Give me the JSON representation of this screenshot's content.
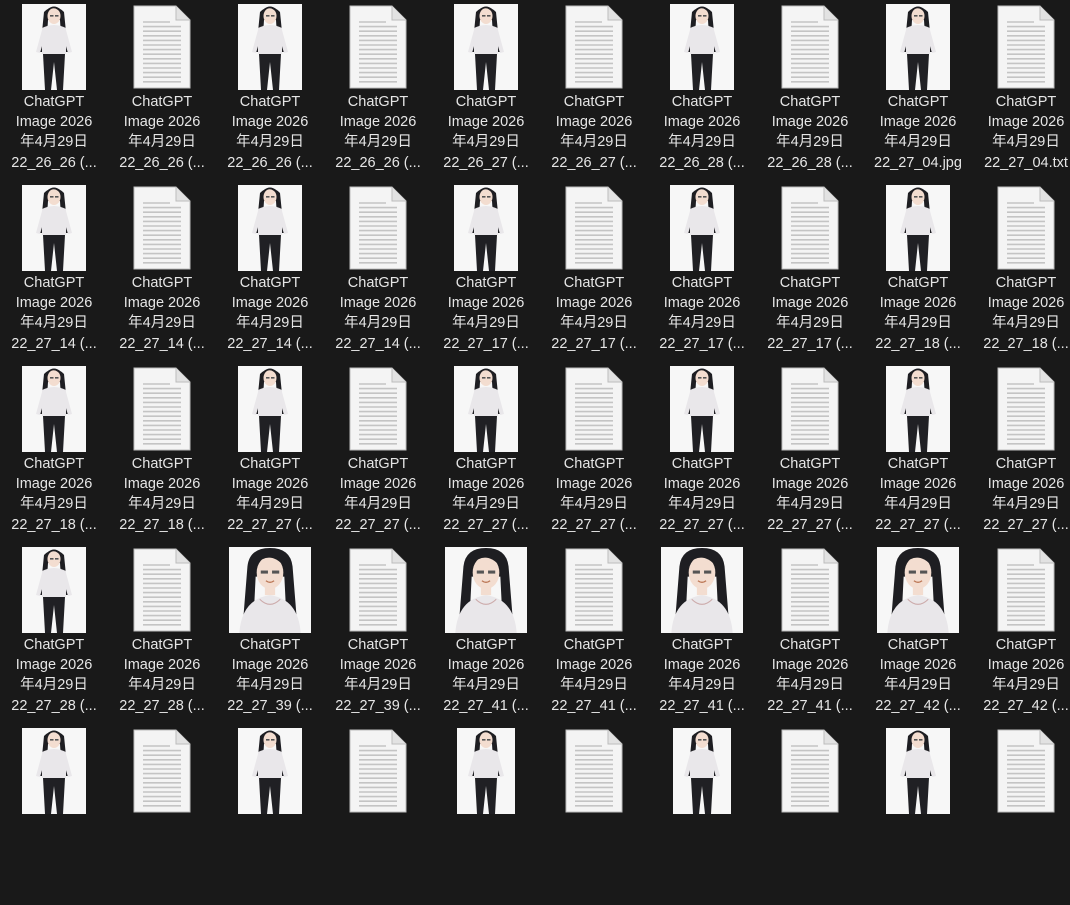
{
  "explorer": {
    "view": "large-icons",
    "items": [
      {
        "kind": "image",
        "icon": "image-thumbnail-icon",
        "lines": [
          "ChatGPT",
          "Image 2026",
          "年4月29日",
          "22_26_26 (..."
        ]
      },
      {
        "kind": "text",
        "icon": "text-file-icon",
        "lines": [
          "ChatGPT",
          "Image 2026",
          "年4月29日",
          "22_26_26 (..."
        ]
      },
      {
        "kind": "image",
        "icon": "image-thumbnail-icon",
        "lines": [
          "ChatGPT",
          "Image 2026",
          "年4月29日",
          "22_26_26 (..."
        ]
      },
      {
        "kind": "text",
        "icon": "text-file-icon",
        "lines": [
          "ChatGPT",
          "Image 2026",
          "年4月29日",
          "22_26_26 (..."
        ]
      },
      {
        "kind": "image",
        "icon": "image-thumbnail-icon",
        "lines": [
          "ChatGPT",
          "Image 2026",
          "年4月29日",
          "22_26_27 (..."
        ]
      },
      {
        "kind": "text",
        "icon": "text-file-icon",
        "lines": [
          "ChatGPT",
          "Image 2026",
          "年4月29日",
          "22_26_27 (..."
        ]
      },
      {
        "kind": "image",
        "icon": "image-thumbnail-icon",
        "lines": [
          "ChatGPT",
          "Image 2026",
          "年4月29日",
          "22_26_28 (..."
        ]
      },
      {
        "kind": "text",
        "icon": "text-file-icon",
        "lines": [
          "ChatGPT",
          "Image 2026",
          "年4月29日",
          "22_26_28 (..."
        ]
      },
      {
        "kind": "image",
        "icon": "image-thumbnail-icon",
        "lines": [
          "ChatGPT",
          "Image 2026",
          "年4月29日",
          "22_27_04.jpg"
        ]
      },
      {
        "kind": "text",
        "icon": "text-file-icon",
        "lines": [
          "ChatGPT",
          "Image 2026",
          "年4月29日",
          "22_27_04.txt"
        ]
      },
      {
        "kind": "image",
        "icon": "image-thumbnail-icon",
        "lines": [
          "ChatGPT",
          "Image 2026",
          "年4月29日",
          "22_27_14 (..."
        ]
      },
      {
        "kind": "text",
        "icon": "text-file-icon",
        "lines": [
          "ChatGPT",
          "Image 2026",
          "年4月29日",
          "22_27_14 (..."
        ]
      },
      {
        "kind": "image",
        "icon": "image-thumbnail-icon",
        "lines": [
          "ChatGPT",
          "Image 2026",
          "年4月29日",
          "22_27_14 (..."
        ]
      },
      {
        "kind": "text",
        "icon": "text-file-icon",
        "lines": [
          "ChatGPT",
          "Image 2026",
          "年4月29日",
          "22_27_14 (..."
        ]
      },
      {
        "kind": "image",
        "icon": "image-thumbnail-icon",
        "lines": [
          "ChatGPT",
          "Image 2026",
          "年4月29日",
          "22_27_17 (..."
        ]
      },
      {
        "kind": "text",
        "icon": "text-file-icon",
        "lines": [
          "ChatGPT",
          "Image 2026",
          "年4月29日",
          "22_27_17 (..."
        ]
      },
      {
        "kind": "image",
        "icon": "image-thumbnail-icon",
        "lines": [
          "ChatGPT",
          "Image 2026",
          "年4月29日",
          "22_27_17 (..."
        ]
      },
      {
        "kind": "text",
        "icon": "text-file-icon",
        "lines": [
          "ChatGPT",
          "Image 2026",
          "年4月29日",
          "22_27_17 (..."
        ]
      },
      {
        "kind": "image",
        "icon": "image-thumbnail-icon",
        "lines": [
          "ChatGPT",
          "Image 2026",
          "年4月29日",
          "22_27_18 (..."
        ]
      },
      {
        "kind": "text",
        "icon": "text-file-icon",
        "lines": [
          "ChatGPT",
          "Image 2026",
          "年4月29日",
          "22_27_18 (..."
        ]
      },
      {
        "kind": "image",
        "icon": "image-thumbnail-icon",
        "lines": [
          "ChatGPT",
          "Image 2026",
          "年4月29日",
          "22_27_18 (..."
        ]
      },
      {
        "kind": "text",
        "icon": "text-file-icon",
        "lines": [
          "ChatGPT",
          "Image 2026",
          "年4月29日",
          "22_27_18 (..."
        ]
      },
      {
        "kind": "image",
        "icon": "image-thumbnail-icon",
        "lines": [
          "ChatGPT",
          "Image 2026",
          "年4月29日",
          "22_27_27 (..."
        ]
      },
      {
        "kind": "text",
        "icon": "text-file-icon",
        "lines": [
          "ChatGPT",
          "Image 2026",
          "年4月29日",
          "22_27_27 (..."
        ]
      },
      {
        "kind": "image",
        "icon": "image-thumbnail-icon",
        "lines": [
          "ChatGPT",
          "Image 2026",
          "年4月29日",
          "22_27_27 (..."
        ]
      },
      {
        "kind": "text",
        "icon": "text-file-icon",
        "lines": [
          "ChatGPT",
          "Image 2026",
          "年4月29日",
          "22_27_27 (..."
        ]
      },
      {
        "kind": "image",
        "icon": "image-thumbnail-icon",
        "lines": [
          "ChatGPT",
          "Image 2026",
          "年4月29日",
          "22_27_27 (..."
        ]
      },
      {
        "kind": "text",
        "icon": "text-file-icon",
        "lines": [
          "ChatGPT",
          "Image 2026",
          "年4月29日",
          "22_27_27 (..."
        ]
      },
      {
        "kind": "image",
        "icon": "image-thumbnail-icon",
        "lines": [
          "ChatGPT",
          "Image 2026",
          "年4月29日",
          "22_27_27 (..."
        ]
      },
      {
        "kind": "text",
        "icon": "text-file-icon",
        "lines": [
          "ChatGPT",
          "Image 2026",
          "年4月29日",
          "22_27_27 (..."
        ]
      },
      {
        "kind": "image",
        "icon": "image-thumbnail-icon",
        "lines": [
          "ChatGPT",
          "Image 2026",
          "年4月29日",
          "22_27_28 (..."
        ]
      },
      {
        "kind": "text",
        "icon": "text-file-icon",
        "lines": [
          "ChatGPT",
          "Image 2026",
          "年4月29日",
          "22_27_28 (..."
        ]
      },
      {
        "kind": "image",
        "icon": "image-thumbnail-icon",
        "lines": [
          "ChatGPT",
          "Image 2026",
          "年4月29日",
          "22_27_39 (..."
        ]
      },
      {
        "kind": "text",
        "icon": "text-file-icon",
        "lines": [
          "ChatGPT",
          "Image 2026",
          "年4月29日",
          "22_27_39 (..."
        ]
      },
      {
        "kind": "image",
        "icon": "image-thumbnail-icon",
        "lines": [
          "ChatGPT",
          "Image 2026",
          "年4月29日",
          "22_27_41 (..."
        ]
      },
      {
        "kind": "text",
        "icon": "text-file-icon",
        "lines": [
          "ChatGPT",
          "Image 2026",
          "年4月29日",
          "22_27_41 (..."
        ]
      },
      {
        "kind": "image",
        "icon": "image-thumbnail-icon",
        "lines": [
          "ChatGPT",
          "Image 2026",
          "年4月29日",
          "22_27_41 (..."
        ]
      },
      {
        "kind": "text",
        "icon": "text-file-icon",
        "lines": [
          "ChatGPT",
          "Image 2026",
          "年4月29日",
          "22_27_41 (..."
        ]
      },
      {
        "kind": "image",
        "icon": "image-thumbnail-icon",
        "lines": [
          "ChatGPT",
          "Image 2026",
          "年4月29日",
          "22_27_42 (..."
        ]
      },
      {
        "kind": "text",
        "icon": "text-file-icon",
        "lines": [
          "ChatGPT",
          "Image 2026",
          "年4月29日",
          "22_27_42 (..."
        ]
      },
      {
        "kind": "image",
        "icon": "image-thumbnail-icon",
        "lines": []
      },
      {
        "kind": "text",
        "icon": "text-file-icon",
        "lines": []
      },
      {
        "kind": "image",
        "icon": "image-thumbnail-icon",
        "lines": []
      },
      {
        "kind": "text",
        "icon": "text-file-icon",
        "lines": []
      },
      {
        "kind": "image",
        "icon": "image-thumbnail-icon",
        "lines": []
      },
      {
        "kind": "text",
        "icon": "text-file-icon",
        "lines": []
      },
      {
        "kind": "image",
        "icon": "image-thumbnail-icon",
        "lines": []
      },
      {
        "kind": "text",
        "icon": "text-file-icon",
        "lines": []
      },
      {
        "kind": "image",
        "icon": "image-thumbnail-icon",
        "lines": []
      },
      {
        "kind": "text",
        "icon": "text-file-icon",
        "lines": []
      }
    ]
  },
  "colors": {
    "background": "#191919",
    "text": "#e6e6e6",
    "thumbnail_background": "#f7f7f7",
    "hair": "#1e1e22",
    "shirt": "#e9e7ea",
    "pants": "#202024"
  }
}
